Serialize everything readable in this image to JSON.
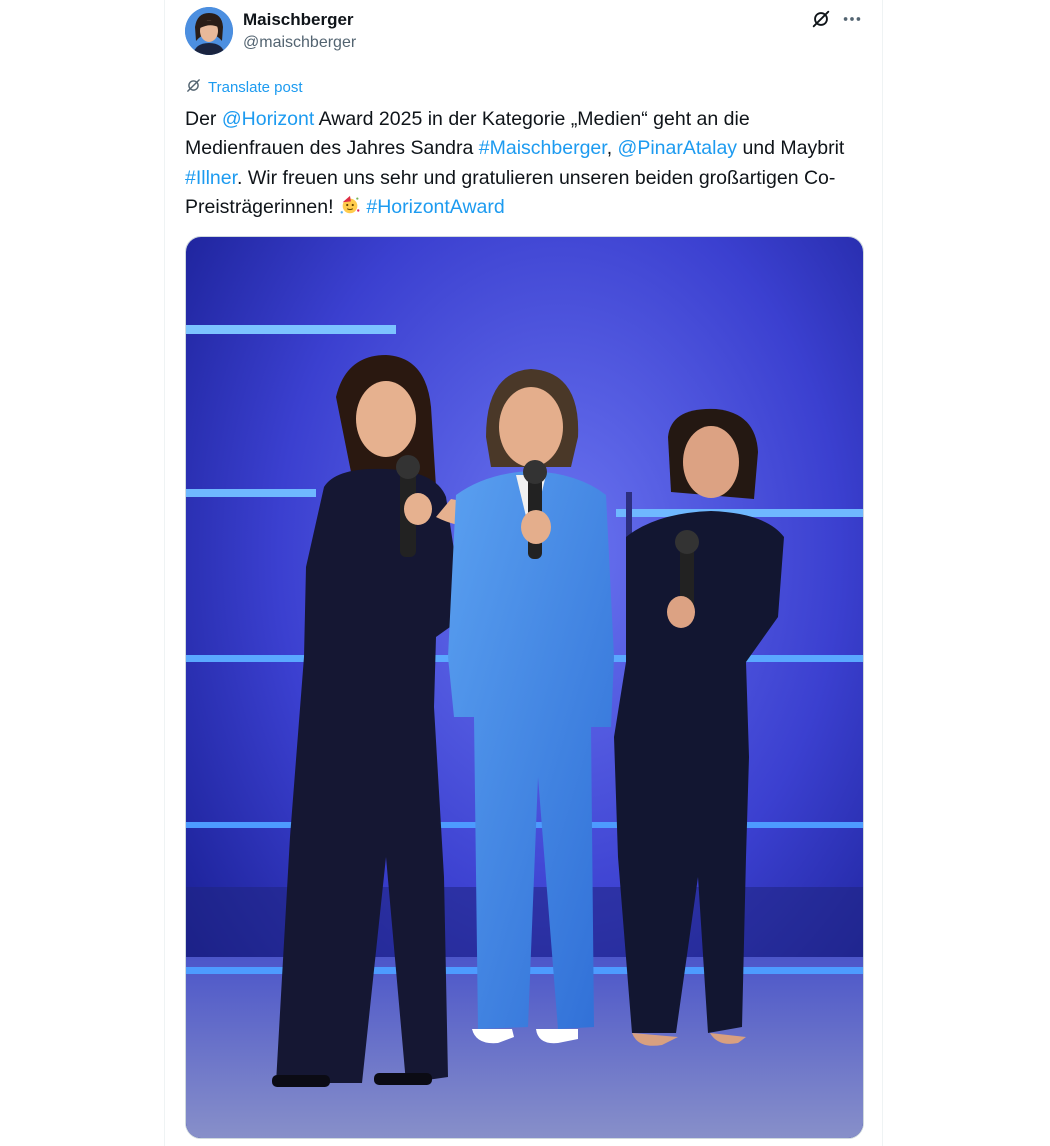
{
  "author": {
    "name": "Maischberger",
    "handle": "@maischberger"
  },
  "actions": {
    "translate_label": "Translate post"
  },
  "tweet": {
    "t1": "Der ",
    "mention1": "@Horizont",
    "t2": " Award 2025 in der Kategorie „Medien“ geht an die Medienfrauen des Jahres Sandra ",
    "hashtag1": "#Maischberger",
    "t3": ", ",
    "mention2": "@PinarAtalay",
    "t4": " und Maybrit ",
    "hashtag2": "#Illner",
    "t5": ". Wir freuen uns sehr und gratulieren unseren beiden großartigen Co-Preisträgerinnen! ",
    "hashtag3": "#HorizontAward"
  },
  "icons": {
    "grok": "grok-icon",
    "more": "more-icon",
    "translate": "translate-icon",
    "emoji": "party-face-emoji"
  },
  "colors": {
    "link": "#1d9bf0",
    "text": "#0f1419",
    "secondary": "#536471"
  }
}
